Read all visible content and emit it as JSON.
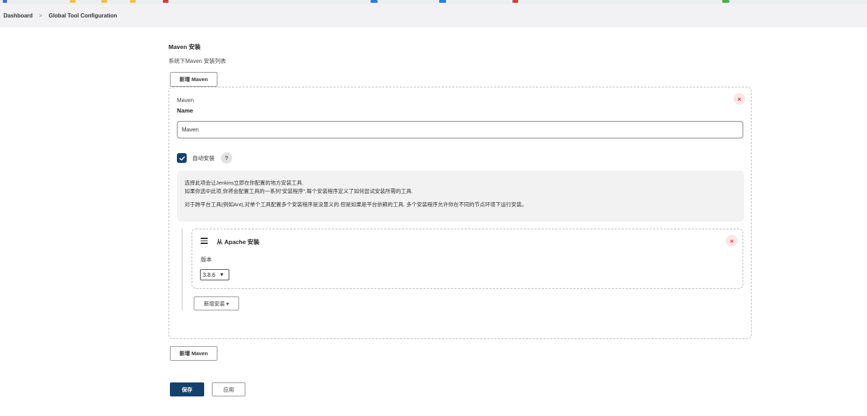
{
  "breadcrumb": {
    "items": [
      "Dashboard",
      "Global Tool Configuration"
    ],
    "separator": ">"
  },
  "maven_section": {
    "title": "Maven 安装",
    "description": "系统下Maven 安装列表",
    "add_button_label": "新增 Maven"
  },
  "maven_installation": {
    "heading": "Maven",
    "name_label": "Name",
    "name_value": "Maven",
    "remove_label": "×",
    "auto_install_label": "自动安装",
    "auto_install_checked": true,
    "help_label": "?",
    "help_lines": [
      "选择此项会让Jenkins立即在你配置的地方安装工具.",
      "如果你选中此项,你将会配置工具的一系列\"安装程序\",每个安装程序定义了如何尝试安装所需的工具.",
      "对于跨平台工具(例如Ant),对单个工具配置多个安装程序是没意义的.但是如果是平台依赖的工具, 多个安装程序允许你在不同的节点环境下运行安装。"
    ],
    "installer": {
      "title": "从 Apache 安装",
      "remove_label": "×",
      "version_label": "版本",
      "version_value": "3.8.6"
    },
    "add_installer_label": "新增安装 ▾"
  },
  "footer": {
    "add_maven_label": "新增 Maven",
    "save_label": "保存",
    "apply_label": "应用"
  },
  "colors": {
    "primary": "#14406c",
    "danger_bg": "#fbe6e6",
    "danger_fg": "#d9363e"
  }
}
